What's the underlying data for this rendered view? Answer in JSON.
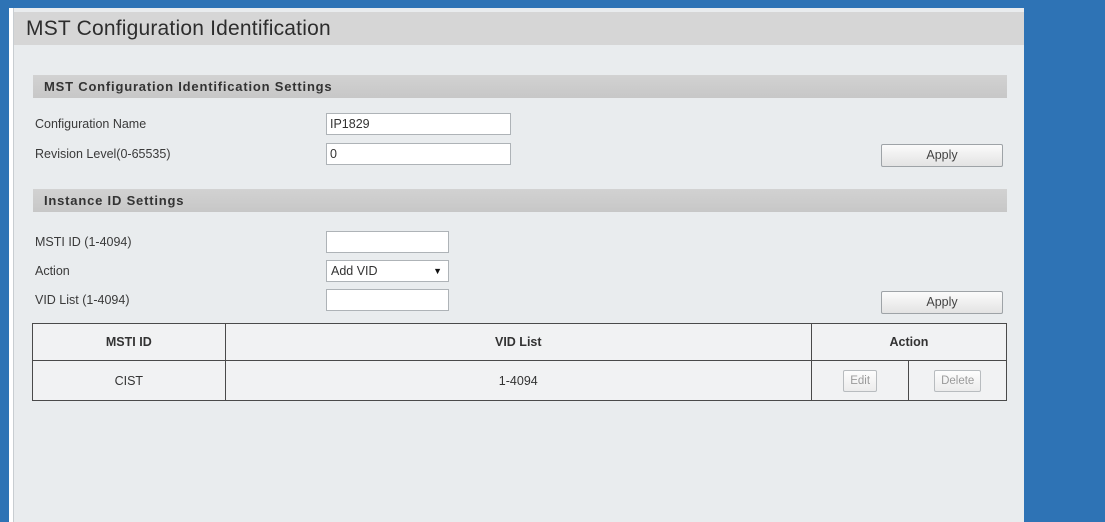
{
  "page": {
    "title": "MST Configuration Identification"
  },
  "mst_settings": {
    "header": "MST Configuration Identification Settings",
    "config_name_label": "Configuration Name",
    "config_name_value": "IP1829",
    "revision_label": "Revision Level(0-65535)",
    "revision_value": "0",
    "apply_label": "Apply"
  },
  "instance_settings": {
    "header": "Instance ID Settings",
    "msti_label": "MSTI ID (1-4094)",
    "msti_value": "",
    "action_label": "Action",
    "action_selected": "Add VID",
    "vid_label": "VID List (1-4094)",
    "vid_value": "",
    "apply_label": "Apply"
  },
  "table": {
    "columns": [
      "MSTI ID",
      "VID List",
      "Action"
    ],
    "rows": [
      {
        "msti_id": "CIST",
        "vid_list": "1-4094",
        "edit_label": "Edit",
        "delete_label": "Delete"
      }
    ]
  },
  "colors": {
    "frame_blue": "#2e73b5",
    "panel_bg": "#e9ecee",
    "section_header_bg": "#c9c9c9"
  }
}
